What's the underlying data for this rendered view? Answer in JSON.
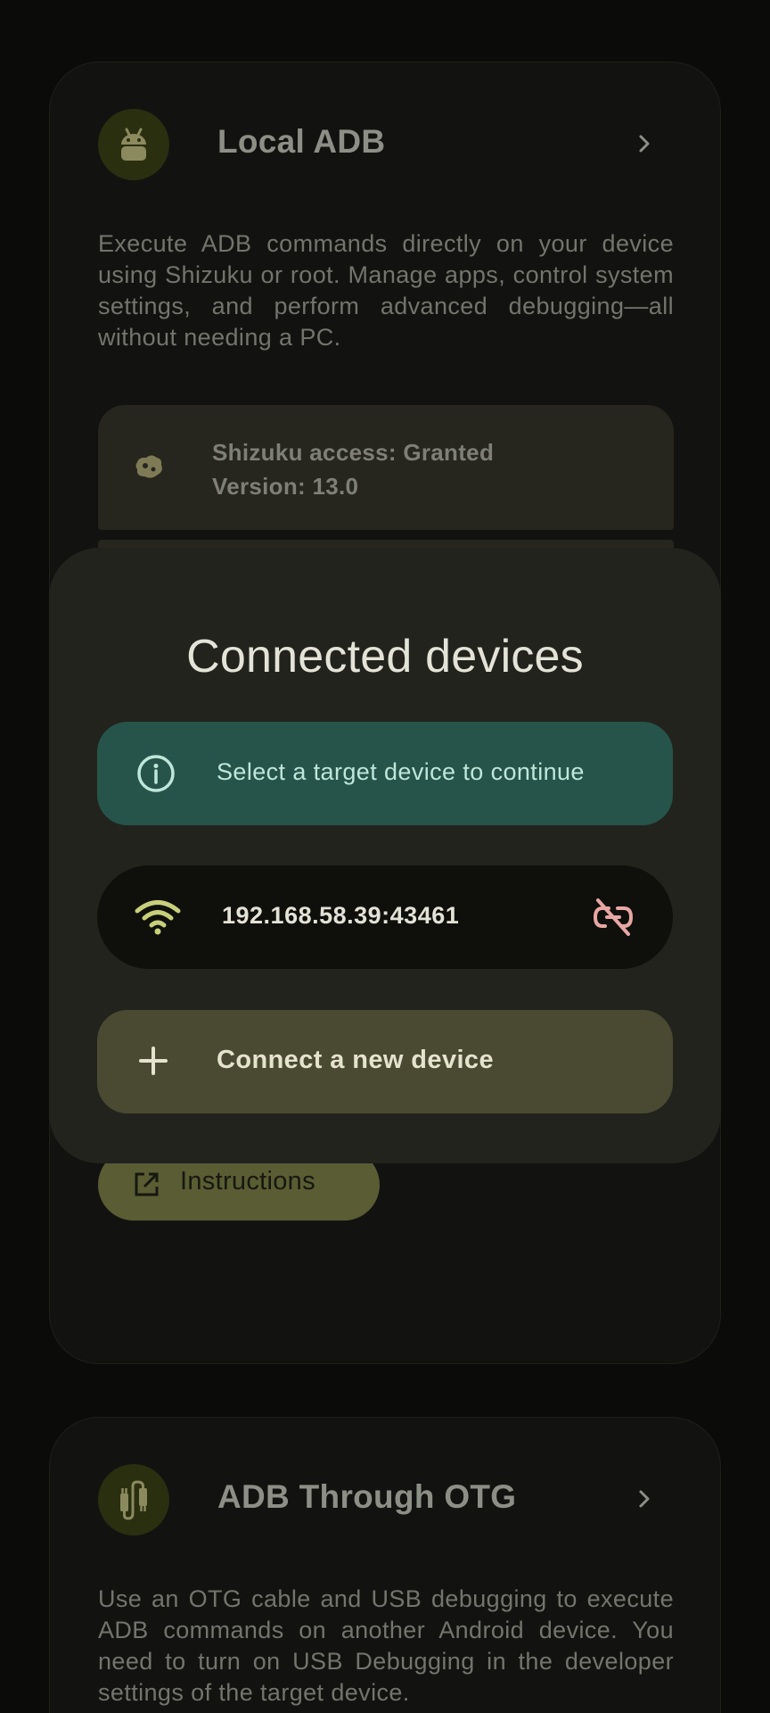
{
  "local_adb": {
    "title": "Local ADB",
    "icon": "android-icon",
    "description": "Execute ADB commands directly on your device using Shizuku or root. Manage apps, control system settings, and perform advanced debugging—all without needing a PC.",
    "status": {
      "access": "Shizuku access: Granted",
      "version": "Version: 13.0",
      "icon": "shizuku-icon"
    },
    "instructions_label": "Instructions"
  },
  "dialog": {
    "title": "Connected devices",
    "info_text": "Select a target device to continue",
    "devices": [
      {
        "address": "192.168.58.39:43461",
        "icon": "wifi-icon",
        "action_icon": "unlink-icon"
      }
    ],
    "connect_label": "Connect a new device"
  },
  "otg_adb": {
    "title": "ADB Through OTG",
    "icon": "usb-cable-icon",
    "description": "Use an OTG cable and USB debugging to execute ADB commands on another Android device. You need to turn on USB Debugging in the developer settings of the target device."
  },
  "colors": {
    "background": "#0b0c09",
    "dialog": "#22231d",
    "info_banner": "#26544a",
    "connect_button": "#4a4a33",
    "unlink_icon": "#e8a7a4",
    "wifi_icon": "#c7cf7a"
  }
}
